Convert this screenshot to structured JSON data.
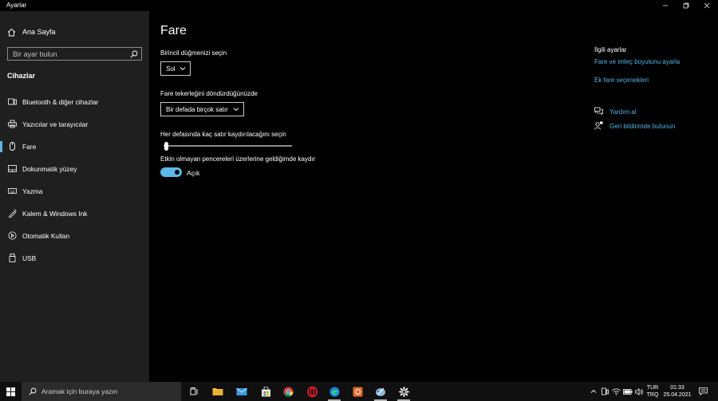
{
  "window": {
    "title": "Ayarlar"
  },
  "sidebar": {
    "home_label": "Ana Sayfa",
    "search_placeholder": "Bir ayar bulun",
    "section_title": "Cihazlar",
    "items": [
      {
        "label": "Bluetooth & diğer cihazlar",
        "icon": "bluetooth-devices-icon"
      },
      {
        "label": "Yazıcılar ve tarayıcılar",
        "icon": "printer-icon"
      },
      {
        "label": "Fare",
        "icon": "mouse-icon",
        "active": true
      },
      {
        "label": "Dokunmatik yüzey",
        "icon": "touchpad-icon"
      },
      {
        "label": "Yazma",
        "icon": "keyboard-icon"
      },
      {
        "label": "Kalem & Windows Ink",
        "icon": "pen-icon"
      },
      {
        "label": "Otomatik Kullan",
        "icon": "autoplay-icon"
      },
      {
        "label": "USB",
        "icon": "usb-icon"
      }
    ]
  },
  "main": {
    "title": "Fare",
    "primary_button_label": "Birincil düğmenizi seçin",
    "primary_button_value": "Sol",
    "wheel_label": "Fare tekerleğini döndürdüğünüzde",
    "wheel_value": "Bir defada birçok satır",
    "lines_label": "Her defasında kaç satır kaydırılacağını seçin",
    "lines_level_fraction": 0.02,
    "inactive_scroll_label": "Etkin olmayan pencereleri üzerlerine geldiğimde kaydır",
    "inactive_scroll_state": "Açık"
  },
  "related": {
    "title": "İlgili ayarlar",
    "link1": "Fare ve imleç boyutunu ayarla",
    "link2": "Ek fare seçenekleri",
    "help": "Yardım al",
    "feedback": "Geri bildirimde bulunun"
  },
  "taskbar": {
    "search_text": "Aramak için buraya yazın",
    "lang_line1": "TUR",
    "lang_line2": "TRQ",
    "time": "01:33",
    "date": "25.04.2021"
  },
  "colors": {
    "accent": "#5ab8e6",
    "link": "#4fb3e8",
    "sidebar_bg": "#1f1f1f",
    "main_bg": "#000000"
  }
}
